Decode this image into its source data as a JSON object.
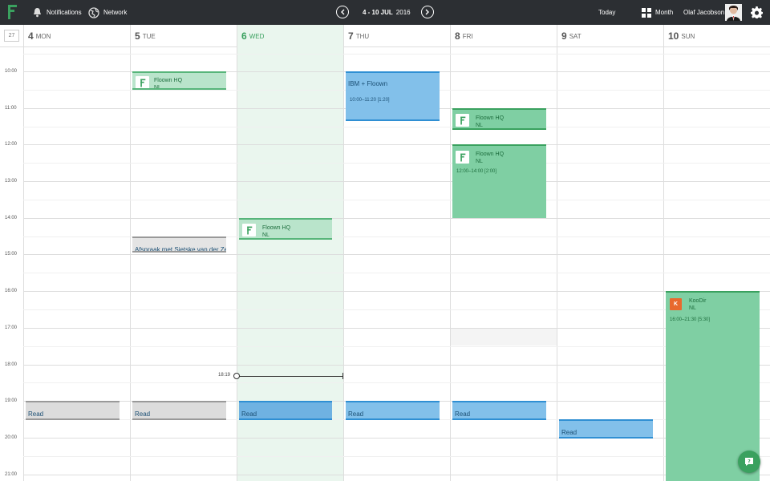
{
  "topbar": {
    "notifications_label": "Notifications",
    "network_label": "Network",
    "range_days": "4 - 10 JUL",
    "range_year": "2016",
    "today_label": "Today",
    "month_label": "Month",
    "user_name": "Olaf Jacobson"
  },
  "week_number": "27",
  "days": [
    {
      "num": "4",
      "name": "MON"
    },
    {
      "num": "5",
      "name": "TUE"
    },
    {
      "num": "6",
      "name": "WED"
    },
    {
      "num": "7",
      "name": "THU"
    },
    {
      "num": "8",
      "name": "FRI"
    },
    {
      "num": "9",
      "name": "SAT"
    },
    {
      "num": "10",
      "name": "SUN"
    }
  ],
  "hours": [
    "10:00",
    "11:00",
    "12:00",
    "13:00",
    "14:00",
    "15:00",
    "16:00",
    "17:00",
    "18:00",
    "19:00",
    "20:00",
    "21:00"
  ],
  "now_label": "18:19",
  "events": {
    "tue_floown": {
      "title": "Floown HQ",
      "sub": "NL"
    },
    "tue_afspraak": {
      "title": "Afspraak met Sietske van der Ze"
    },
    "wed_floown": {
      "title": "Floown HQ",
      "sub": "NL"
    },
    "thu_ibm": {
      "title": "IBM + Floown",
      "time": "10:00–11:20 [1:20]"
    },
    "fri_floown1": {
      "title": "Floown HQ",
      "sub": "NL"
    },
    "fri_floown2": {
      "title": "Floown HQ",
      "sub": "NL",
      "time": "12:00–14:00 [2:00]"
    },
    "sun_koodir": {
      "title": "KooDir",
      "sub": "NL",
      "time": "16:00–21:30 [5:30]",
      "icon_letter": "K"
    },
    "read_label": "Read"
  },
  "colors": {
    "accent": "#3aa15f",
    "topbar": "#2c2f33",
    "blue": "#82c0ea",
    "green": "#7fcfa3"
  }
}
